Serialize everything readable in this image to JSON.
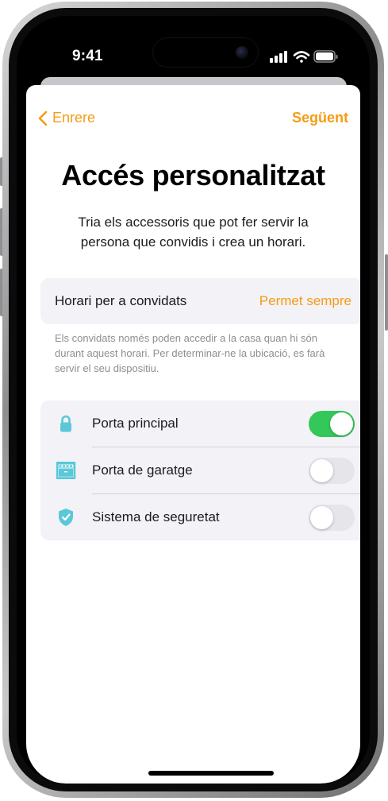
{
  "status_bar": {
    "time": "9:41"
  },
  "nav": {
    "back_label": "Enrere",
    "next_label": "Següent"
  },
  "header": {
    "title": "Accés personalitzat",
    "subtitle": "Tria els accessoris que pot fer servir la persona que convidis i crea un horari."
  },
  "schedule": {
    "label": "Horari per a convidats",
    "value": "Permet sempre",
    "footnote": "Els convidats només poden accedir a la casa quan hi són durant aquest horari. Per determinar-ne la ubicació, es farà servir el seu dispositiu."
  },
  "accessories": [
    {
      "label": "Porta principal",
      "icon": "lock-icon",
      "enabled": true
    },
    {
      "label": "Porta de garatge",
      "icon": "garage-door-icon",
      "enabled": false
    },
    {
      "label": "Sistema de seguretat",
      "icon": "security-shield-icon",
      "enabled": false
    }
  ],
  "colors": {
    "accent": "#f59c13",
    "toggle_on": "#34c759",
    "icon_teal": "#5ac8d8",
    "group_bg": "#f2f2f7"
  }
}
